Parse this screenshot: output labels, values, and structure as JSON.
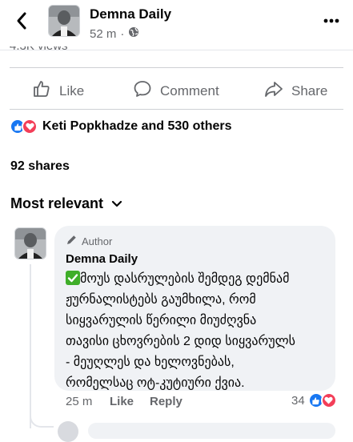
{
  "header": {
    "title": "Demna Daily",
    "time": "52 m",
    "dot": "·",
    "back_icon": "chevron-left-icon",
    "privacy_icon": "globe-icon",
    "more_icon": "more-dots-icon"
  },
  "post": {
    "views_partial": "4.3K views",
    "actions": [
      {
        "label": "Like",
        "icon": "thumbs-up-icon"
      },
      {
        "label": "Comment",
        "icon": "comment-icon"
      },
      {
        "label": "Share",
        "icon": "share-icon"
      }
    ],
    "reactions_text": "Keti Popkhadze and 530 others",
    "shares_text": "92 shares",
    "sort_label": "Most relevant"
  },
  "comment": {
    "badge": "Author",
    "name": "Demna Daily",
    "text": "მოუს დასრულების შემდეგ დემნამ\nჟურნალისტებს გაუმხილა, რომ\nსიყვარულის წერილი მიუძღვნა\nთავისი ცხოვრების 2 დიდ სიყვარულს\n- მეუღლეს და ხელოვნებას,\nრომელსაც ოტ-კუტიური ქვია.",
    "time": "25 m",
    "like_label": "Like",
    "reply_label": "Reply",
    "reaction_count": "34"
  },
  "colors": {
    "like_blue": "#1877f2",
    "love_red": "#f33e58",
    "secondary_text": "#65676b",
    "bubble_bg": "#f0f2f5",
    "check_green": "#3fae29"
  }
}
